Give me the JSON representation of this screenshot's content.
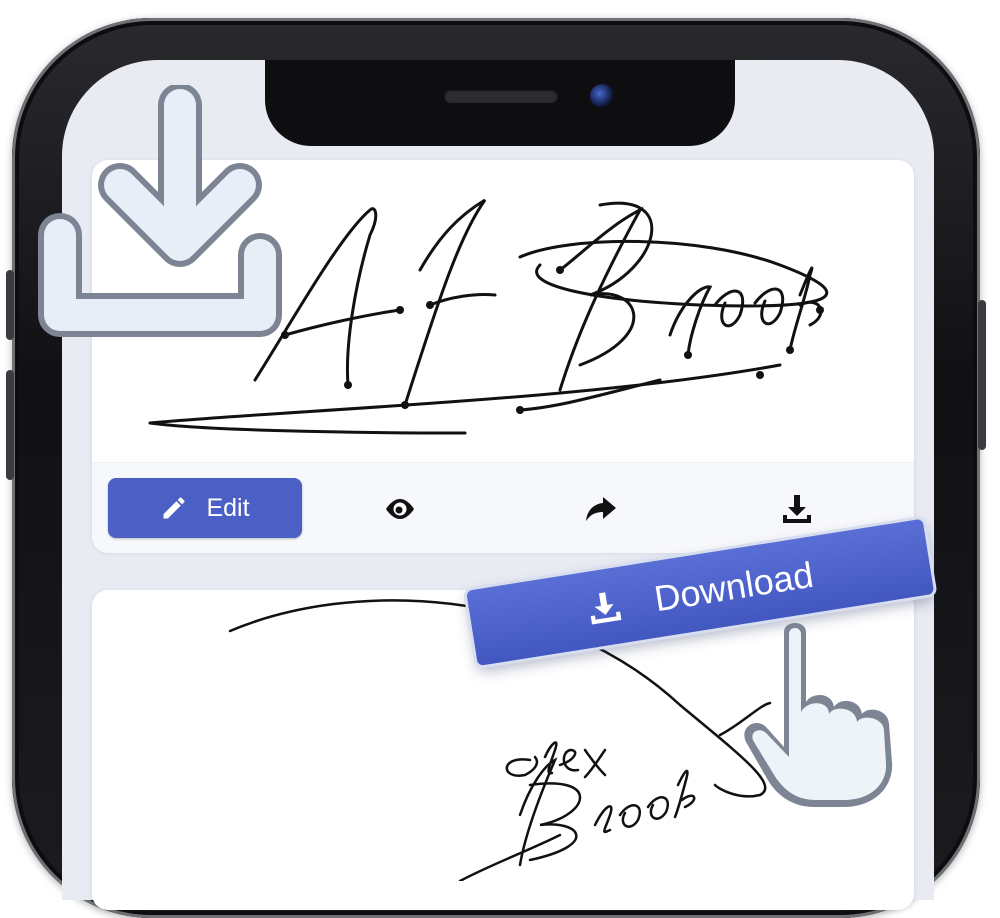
{
  "toolbar": {
    "edit_label": "Edit",
    "preview_icon": "eye-icon",
    "share_icon": "share-arrow-icon",
    "download_icon": "download-icon"
  },
  "download_button": {
    "label": "Download",
    "icon": "download-icon"
  },
  "colors": {
    "accent": "#4b5fc5",
    "screen_bg": "#e8ebf2",
    "phone_frame": "#16161a"
  }
}
